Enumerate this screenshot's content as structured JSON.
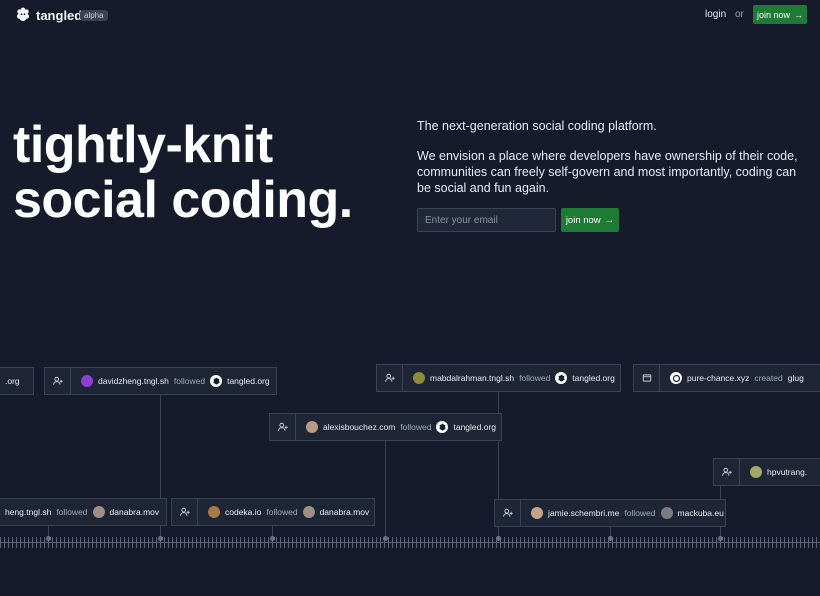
{
  "nav": {
    "brand": "tangled",
    "badge": "alpha",
    "login": "login",
    "or": "or",
    "join": "join now"
  },
  "hero": {
    "title_line1": "tightly-knit",
    "title_line2": "social coding.",
    "tagline": "The next-generation social coding platform.",
    "vision": "We envision a place where developers have ownership of their code, communities can freely self-govern and most importantly, coding can be social and fun again.",
    "email_placeholder": "Enter your email",
    "join": "join now"
  },
  "timeline": [
    {
      "actor": ".org",
      "verb": "",
      "target": ""
    },
    {
      "actor": "davidzheng.tngl.sh",
      "verb": "followed",
      "target": "tangled.org"
    },
    {
      "actor": "mabdalrahman.tngl.sh",
      "verb": "followed",
      "target": "tangled.org"
    },
    {
      "actor": "pure-chance.xyz",
      "verb": "created",
      "target": "glug"
    },
    {
      "actor": "alexisbouchez.com",
      "verb": "followed",
      "target": "tangled.org"
    },
    {
      "actor": "hpvutrang.",
      "verb": "",
      "target": ""
    },
    {
      "actor": "heng.tngl.sh",
      "verb": "followed",
      "target": "danabra.mov"
    },
    {
      "actor": "codeka.io",
      "verb": "followed",
      "target": "danabra.mov"
    },
    {
      "actor": "jamie.schembri.me",
      "verb": "followed",
      "target": "mackuba.eu"
    }
  ],
  "colors": {
    "background": "#151b2b",
    "accent": "#1f7a36",
    "card": "#1e2534"
  }
}
